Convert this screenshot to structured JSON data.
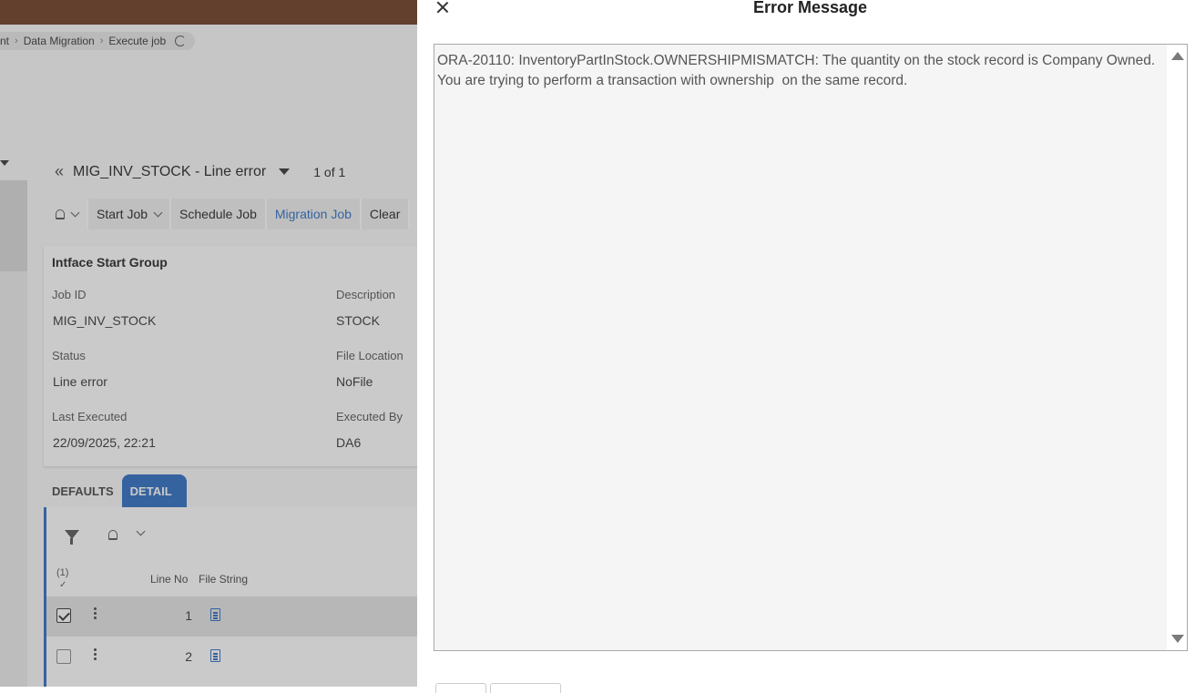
{
  "breadcrumb": {
    "items": [
      "nt",
      "Data Migration",
      "Execute job"
    ]
  },
  "page": {
    "title": "MIG_INV_STOCK - Line error",
    "pager": "1 of 1"
  },
  "toolbar": {
    "start_job": "Start Job",
    "schedule_job": "Schedule Job",
    "migration_job": "Migration Job",
    "clear": "Clear"
  },
  "card": {
    "title": "Intface Start Group",
    "job_id_label": "Job ID",
    "job_id_value": "MIG_INV_STOCK",
    "description_label": "Description",
    "description_value": "STOCK",
    "status_label": "Status",
    "status_value": "Line error",
    "file_location_label": "File Location",
    "file_location_value": "NoFile",
    "last_executed_label": "Last Executed",
    "last_executed_value": "22/09/2025, 22:21",
    "executed_by_label": "Executed By",
    "executed_by_value": "DA6"
  },
  "tabs": {
    "defaults": "DEFAULTS",
    "detail": "DETAIL"
  },
  "detail": {
    "selected_count": "(1)",
    "check_mark": "✓",
    "col_line_no": "Line No",
    "col_file_string": "File String",
    "rows": [
      {
        "line_no": "1",
        "selected": true
      },
      {
        "line_no": "2",
        "selected": false
      }
    ]
  },
  "dialog": {
    "title": "Error Message",
    "message": "ORA-20110: InventoryPartInStock.OWNERSHIPMISMATCH: The quantity on the stock record is Company Owned. You are trying to perform a transaction with ownership  on the same record."
  },
  "colors": {
    "accent": "#2a6cc2",
    "topbar": "#6b3a1f"
  }
}
